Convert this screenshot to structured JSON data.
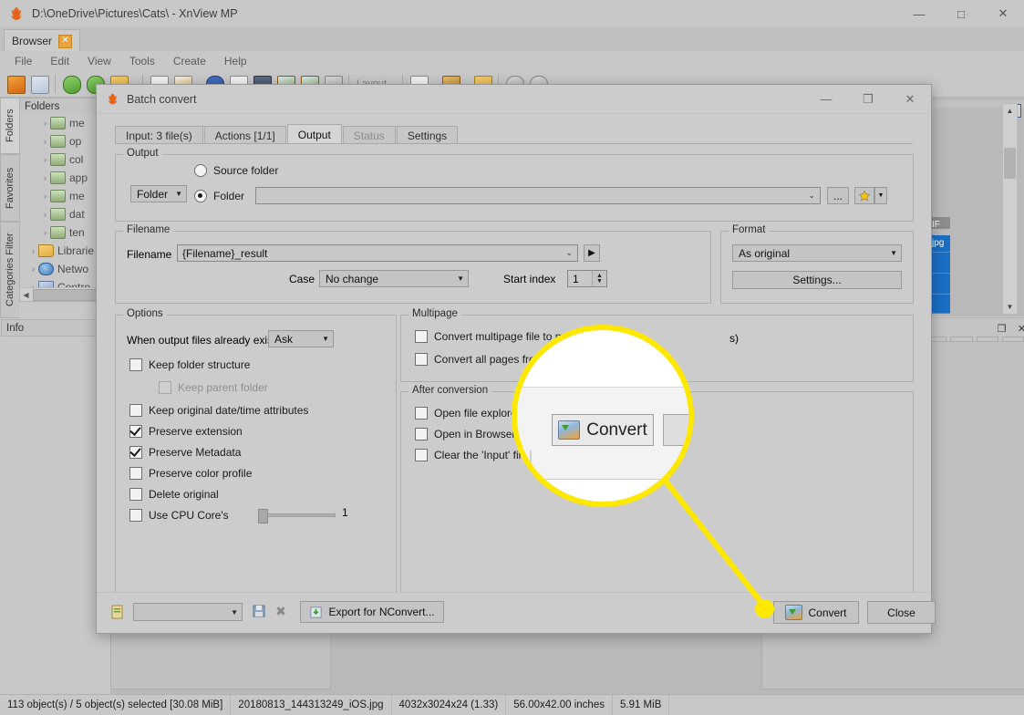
{
  "main_window": {
    "title": "D:\\OneDrive\\Pictures\\Cats\\ - XnView MP",
    "app_icon": "xnview-icon",
    "window_controls": {
      "minimize": "—",
      "maximize": "□",
      "close": "✕"
    },
    "tab": {
      "label": "Browser",
      "close_glyph": "✕"
    },
    "menus": [
      "File",
      "Edit",
      "View",
      "Tools",
      "Create",
      "Help"
    ],
    "toolbar": {
      "layout_label": "Layout"
    },
    "vertical_tabs": [
      "Folders",
      "Favorites",
      "Categories Filter"
    ],
    "folders_panel": {
      "header": "Folders"
    },
    "folder_tree": [
      {
        "label": "me",
        "icon": "drive-icon",
        "chevron": "›",
        "indent": 1
      },
      {
        "label": "op",
        "icon": "drive-icon",
        "chevron": "›",
        "indent": 1
      },
      {
        "label": "col",
        "icon": "drive-icon",
        "chevron": "›",
        "indent": 1
      },
      {
        "label": "app",
        "icon": "drive-icon",
        "chevron": "›",
        "indent": 1
      },
      {
        "label": "me",
        "icon": "drive-icon",
        "chevron": "›",
        "indent": 1
      },
      {
        "label": "dat",
        "icon": "drive-icon",
        "chevron": "›",
        "indent": 1
      },
      {
        "label": "ten",
        "icon": "drive-icon",
        "chevron": "›",
        "indent": 1
      },
      {
        "label": "Librarie",
        "icon": "library-icon",
        "chevron": "›",
        "indent": 0
      },
      {
        "label": "Netwo",
        "icon": "network-icon",
        "chevron": "›",
        "indent": 0
      },
      {
        "label": "Contro",
        "icon": "control-panel-icon",
        "chevron": "›",
        "indent": 0
      }
    ],
    "info_panel": {
      "header": "Info"
    },
    "file_chips": [
      "IF",
      "jpg"
    ],
    "status_bar": [
      "113 object(s) / 5 object(s) selected [30.08 MiB]",
      "20180813_144313249_iOS.jpg",
      "4032x3024x24 (1.33)",
      "56.00x42.00 inches",
      "5.91 MiB"
    ]
  },
  "dialog": {
    "title": "Batch convert",
    "icon": "xnview-icon",
    "window_controls": {
      "minimize": "—",
      "maximize": "❐",
      "close": "✕"
    },
    "tabs": [
      {
        "label": "Input: 3 file(s)",
        "state": "normal"
      },
      {
        "label": "Actions [1/1]",
        "state": "normal"
      },
      {
        "label": "Output",
        "state": "active"
      },
      {
        "label": "Status",
        "state": "disabled"
      },
      {
        "label": "Settings",
        "state": "normal"
      }
    ],
    "output_group": {
      "legend": "Output",
      "mode_combo": {
        "value": "Folder",
        "caret": "▼"
      },
      "source_folder_radio": {
        "label": "Source folder",
        "checked": false
      },
      "folder_radio": {
        "label": "Folder",
        "checked": true
      },
      "folder_field": {
        "value": "",
        "caret": "⌄"
      },
      "browse_button": "...",
      "favorite_button": {
        "icon": "star-icon",
        "caret": "▼"
      }
    },
    "filename_group": {
      "legend": "Filename",
      "filename_label": "Filename",
      "filename_value": "{Filename}_result",
      "filename_caret": "⌄",
      "insert_button": "▶",
      "case_label": "Case",
      "case_value": "No change",
      "case_caret": "▼",
      "start_index_label": "Start index",
      "start_index_value": "1"
    },
    "format_group": {
      "legend": "Format",
      "format_value": "As original",
      "format_caret": "▼",
      "settings_button": "Settings..."
    },
    "options_group": {
      "legend": "Options",
      "exists_label": "When output files already exist",
      "exists_value": "Ask",
      "exists_caret": "▼",
      "checkboxes": [
        {
          "label": "Keep folder structure",
          "checked": false,
          "disabled": false
        },
        {
          "label": "Keep parent folder",
          "checked": false,
          "disabled": true
        },
        {
          "label": "Keep original date/time attributes",
          "checked": false,
          "disabled": false
        },
        {
          "label": "Preserve extension",
          "checked": true,
          "disabled": false
        },
        {
          "label": "Preserve Metadata",
          "checked": true,
          "disabled": false
        },
        {
          "label": "Preserve color profile",
          "checked": false,
          "disabled": false
        },
        {
          "label": "Delete original",
          "checked": false,
          "disabled": false
        },
        {
          "label": "Use CPU Core's",
          "checked": false,
          "disabled": false
        }
      ],
      "cpu_cores_value": "1"
    },
    "multipage_group": {
      "legend": "Multipage",
      "checkboxes": [
        {
          "label": "Convert multipage file to m",
          "suffix": "s)",
          "checked": false
        },
        {
          "label": "Convert all pages from",
          "suffix": "",
          "checked": false
        }
      ]
    },
    "after_conversion_group": {
      "legend": "After conversion",
      "checkboxes": [
        {
          "label": "Open file explorer",
          "checked": false
        },
        {
          "label": "Open in Browser",
          "checked": false
        },
        {
          "label": "Clear the 'Input' file(s)",
          "checked": false
        }
      ]
    },
    "bottom_bar": {
      "script_icon": "script-icon",
      "preset_combo": {
        "value": "",
        "caret": "▼"
      },
      "save_icon": "save-icon",
      "delete_icon": "delete-icon",
      "export_button": {
        "label": "Export for NConvert...",
        "icon": "export-icon"
      },
      "convert_button": {
        "label": "Convert",
        "icon": "convert-icon"
      },
      "close_button": "Close"
    }
  },
  "magnifier": {
    "convert_label": "Convert",
    "convert_icon": "convert-icon",
    "highlight_color": "#ffe800"
  }
}
